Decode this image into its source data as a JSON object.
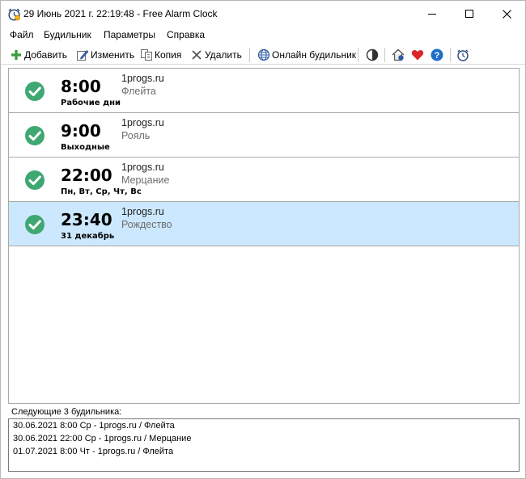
{
  "window": {
    "title": "29 Июнь 2021 г. 22:19:48 - Free Alarm Clock"
  },
  "menu": [
    "Файл",
    "Будильник",
    "Параметры",
    "Справка"
  ],
  "toolbar": {
    "add": "Добавить",
    "edit": "Изменить",
    "copy": "Копия",
    "delete": "Удалить",
    "online": "Онлайн будильник"
  },
  "alarms": [
    {
      "time": "8:00",
      "days": "Рабочие дни",
      "label": "1progs.ru",
      "sound": "Флейта",
      "enabled": true,
      "selected": false
    },
    {
      "time": "9:00",
      "days": "Выходные",
      "label": "1progs.ru",
      "sound": "Рояль",
      "enabled": true,
      "selected": false
    },
    {
      "time": "22:00",
      "days": "Пн, Вт, Ср, Чт, Вс",
      "label": "1progs.ru",
      "sound": "Мерцание",
      "enabled": true,
      "selected": false
    },
    {
      "time": "23:40",
      "days": "31 декабрь",
      "label": "1progs.ru",
      "sound": "Рождество",
      "enabled": true,
      "selected": true
    }
  ],
  "next": {
    "title": "Следующие 3 будильника:",
    "items": [
      "30.06.2021 8:00 Ср - 1progs.ru / Флейта",
      "30.06.2021 22:00 Ср - 1progs.ru / Мерцание",
      "01.07.2021 8:00 Чт - 1progs.ru / Флейта"
    ]
  },
  "colors": {
    "check_green": "#3fa872",
    "selected_row": "#cce8ff",
    "heart_red": "#d9262c",
    "help_blue": "#1e6fc9"
  }
}
